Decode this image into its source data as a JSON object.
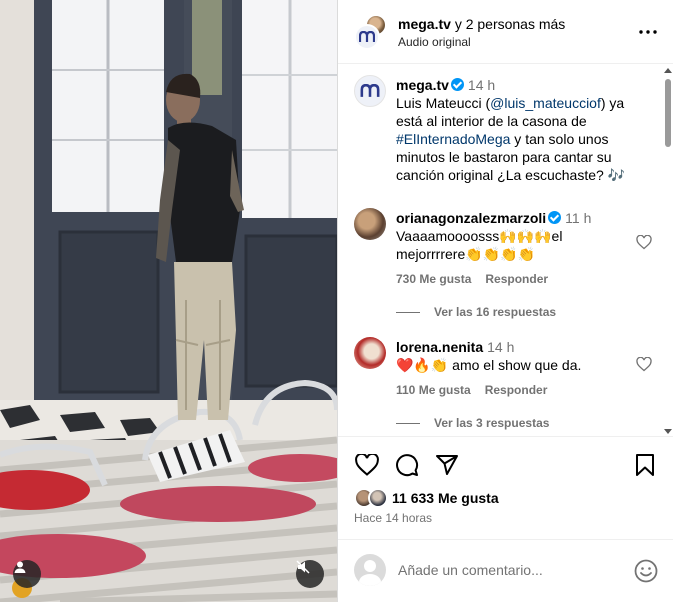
{
  "header": {
    "account": "mega.tv",
    "others": "y 2 personas más",
    "audio": "Audio original"
  },
  "caption": {
    "username": "mega.tv",
    "time": "14 h",
    "text_1": "Luis Mateucci (",
    "mention": "@luis_mateucciof",
    "text_2": ") ya está al interior de la casona de ",
    "hashtag": "#ElInternadoMega",
    "text_3": " y tan solo unos minutos le bastaron para cantar su canción original ¿La escuchaste? 🎶"
  },
  "comments": [
    {
      "username": "orianagonzalezmarzoli",
      "verified": true,
      "time": "11 h",
      "text": "Vaaaamoooosss🙌🙌🙌el mejorrrrere👏👏👏👏",
      "likes": "730 Me gusta",
      "reply_label": "Responder",
      "view_replies": "Ver las 16 respuestas"
    },
    {
      "username": "lorena.nenita",
      "verified": false,
      "time": "14 h",
      "text": "❤️🔥👏 amo el show que da.",
      "likes": "110 Me gusta",
      "reply_label": "Responder",
      "view_replies": "Ver las 3 respuestas"
    }
  ],
  "post": {
    "likes": "11 633 Me gusta",
    "time": "Hace 14 horas"
  },
  "add_comment": {
    "placeholder": "Añade un comentario..."
  },
  "icons": {
    "more": "more-options-icon",
    "like": "heart-icon",
    "comment": "comment-icon",
    "share": "send-icon",
    "save": "bookmark-icon",
    "emoji": "emoji-icon",
    "tag": "person-tag-icon",
    "mute": "muted-speaker-icon"
  },
  "colors": {
    "link": "#00376b",
    "verified": "#0095f6",
    "secondary_text": "#737373",
    "border": "#dbdbdb"
  }
}
